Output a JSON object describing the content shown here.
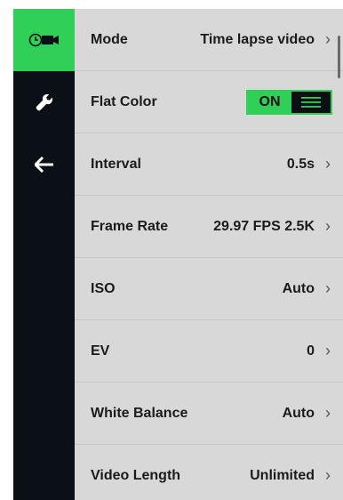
{
  "sidebar": {
    "items": [
      {
        "icon": "timelapse-video-icon",
        "active": true
      },
      {
        "icon": "wrench-icon",
        "active": false
      },
      {
        "icon": "back-arrow-icon",
        "active": false
      }
    ]
  },
  "settings": {
    "mode": {
      "label": "Mode",
      "value": "Time lapse video"
    },
    "flat_color": {
      "label": "Flat Color",
      "toggle_text": "ON",
      "state": "on"
    },
    "interval": {
      "label": "Interval",
      "value": "0.5s"
    },
    "frame_rate": {
      "label": "Frame Rate",
      "value": "29.97 FPS 2.5K"
    },
    "iso": {
      "label": "ISO",
      "value": "Auto"
    },
    "ev": {
      "label": "EV",
      "value": "0"
    },
    "white_balance": {
      "label": "White Balance",
      "value": "Auto"
    },
    "video_length": {
      "label": "Video Length",
      "value": "Unlimited"
    }
  },
  "chevron": "›",
  "colors": {
    "accent": "#2fcf58",
    "sidebar_bg": "#0a1016",
    "panel_bg": "#d8d8d8"
  }
}
